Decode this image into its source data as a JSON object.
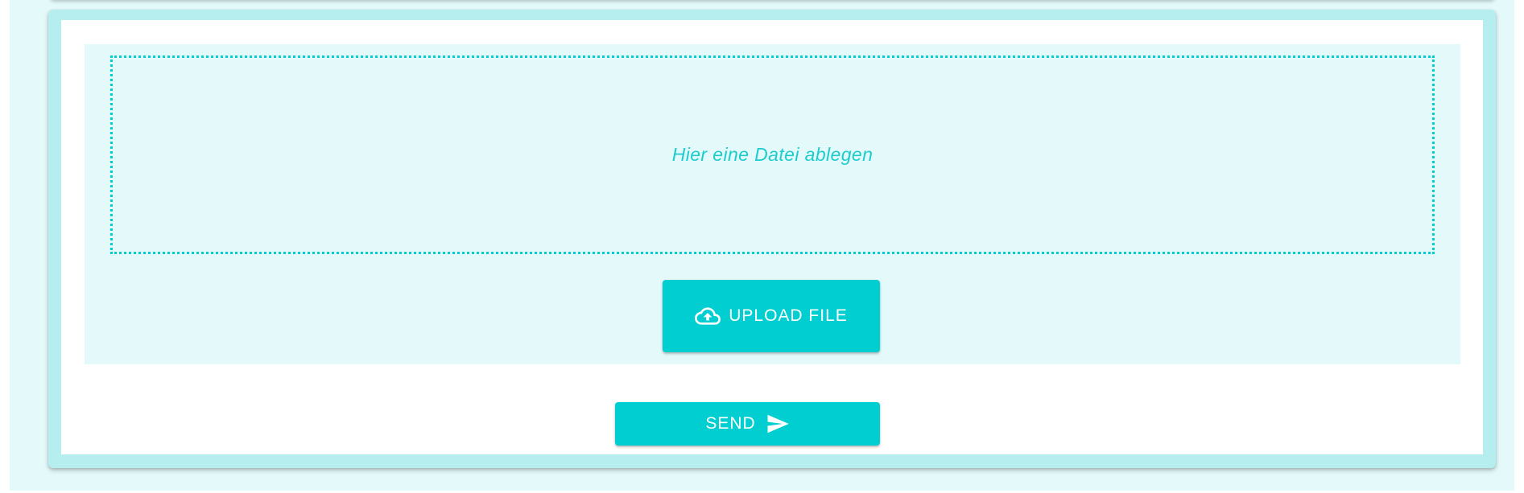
{
  "dropzone": {
    "label": "Hier eine Datei ablegen"
  },
  "upload": {
    "button_label": "UPLOAD FILE",
    "icon": "cloud-upload-icon"
  },
  "send": {
    "button_label": "SEND",
    "icon": "send-icon"
  },
  "colors": {
    "accent": "#00ced1",
    "page_background": "#e4fafa",
    "card_border": "#b6eef0",
    "card_background": "#ffffff"
  }
}
